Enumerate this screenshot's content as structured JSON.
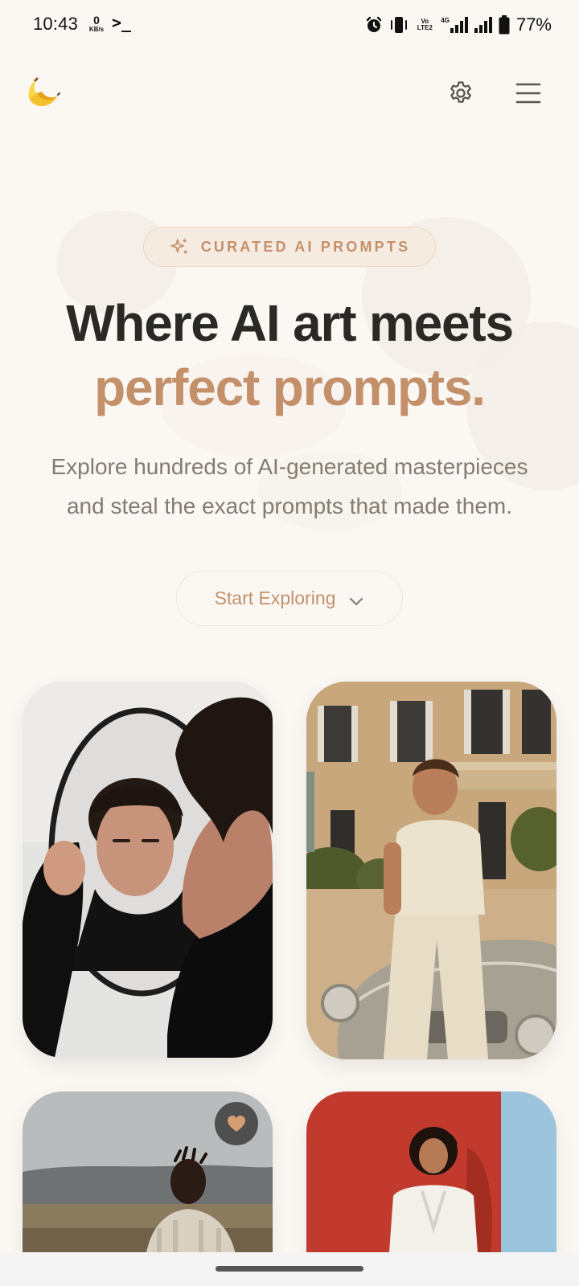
{
  "status_bar": {
    "time": "10:43",
    "net_speed_value": "0",
    "net_speed_unit": "KB/s",
    "terminal_glyph": ">_",
    "volte_label": "Vo LTE2",
    "network_type": "4G",
    "battery_percent": "77%"
  },
  "header": {
    "logo_icon": "banana-icon",
    "settings_icon": "gear-icon",
    "menu_icon": "hamburger-menu-icon"
  },
  "hero": {
    "badge_label": "CURATED AI PROMPTS",
    "headline_line1": "Where AI art meets",
    "headline_line2": "perfect prompts.",
    "subtitle_line1": "Explore hundreds of AI-generated masterpieces",
    "subtitle_line2": "and steal the exact prompts that made them.",
    "cta_label": "Start Exploring"
  },
  "gallery": {
    "items": [
      {
        "image": "man in black turtleneck holding round mirror"
      },
      {
        "image": "man in cream outfit leaning on vintage car"
      },
      {
        "image": "man in cable-knit sweater in landscape",
        "favorite_icon": "heart-icon"
      },
      {
        "image": "woman in white suit against red wall"
      }
    ]
  },
  "colors": {
    "background": "#fbf8f4",
    "accent": "#c4906a",
    "headline": "#2b2925",
    "body_text": "#857b70"
  }
}
